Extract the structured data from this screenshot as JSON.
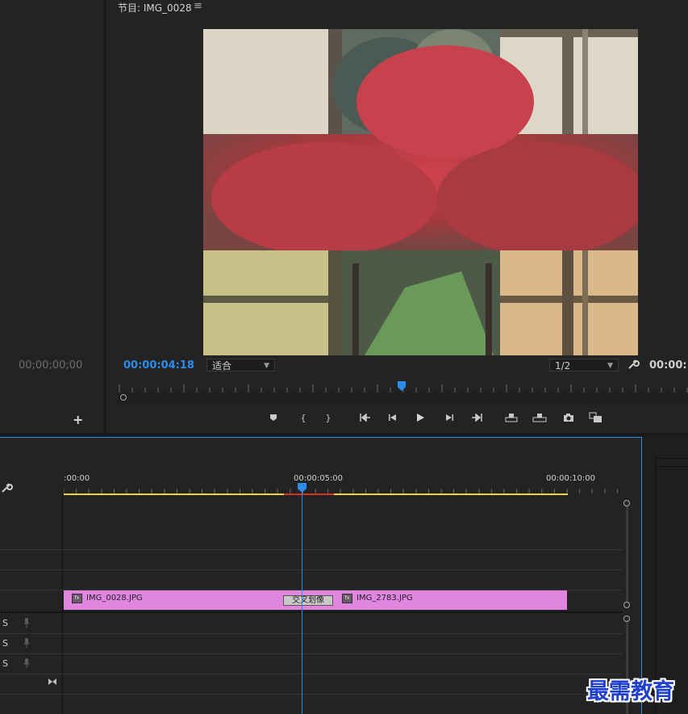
{
  "monitor": {
    "title": "节目: IMG_0028",
    "menu_icon": "hamburger-icon",
    "left_timecode": "00;00;00;00",
    "current_timecode": "00:00:04:18",
    "right_timecode": "00:00:1",
    "zoom_value": "适合",
    "resolution_value": "1/2",
    "controls": [
      "marker-icon",
      "mark-in-icon",
      "mark-out-icon",
      "go-to-in-icon",
      "step-back-icon",
      "play-icon",
      "step-forward-icon",
      "go-to-out-icon",
      "lift-icon",
      "extract-icon",
      "camera-icon",
      "compare-icon"
    ]
  },
  "timeline": {
    "ruler_labels": [
      ":00:00",
      "00:00:05:00",
      "00:00:10:00"
    ],
    "clips": [
      {
        "name": "IMG_0028.JPG"
      },
      {
        "name": "IMG_2783.JPG"
      }
    ],
    "transition_label": "交叉划像",
    "audio_solo_labels": [
      "S",
      "S",
      "S"
    ],
    "colors": {
      "clip": "#e085e0",
      "playhead": "#2d8ceb",
      "work_area": "#e6d63a",
      "render_bar_red": "#d9302f"
    }
  },
  "watermark": "最需教育"
}
